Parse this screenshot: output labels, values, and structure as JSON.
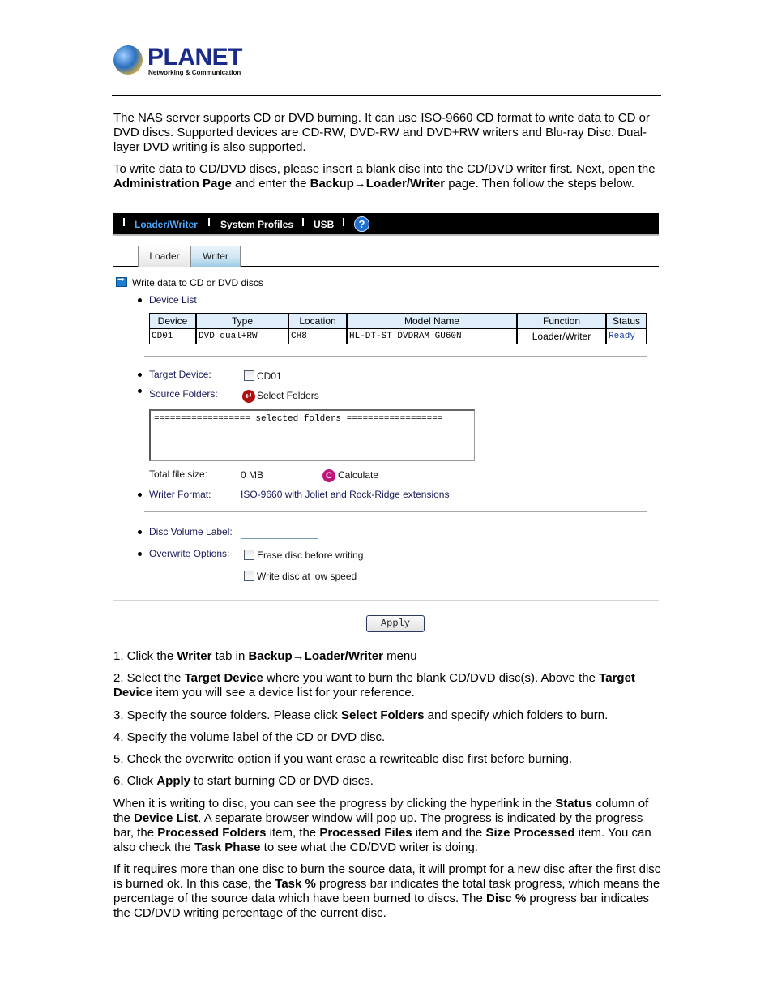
{
  "logo": {
    "brand": "PLANET",
    "tagline": "Networking & Communication"
  },
  "intro": {
    "p1": "The NAS server supports CD or DVD burning. It can use ISO-9660 CD format to write data to CD or DVD discs. Supported devices are CD-RW, DVD-RW and DVD+RW writers and Blu-ray Disc. Dual-layer DVD writing is also supported.",
    "p2_a": "To write data to CD/DVD discs, please insert a blank disc into the CD/DVD writer first. Next, open the ",
    "p2_b": "Administration Page",
    "p2_c": " and enter the ",
    "p2_d": "Backup→Loader/Writer",
    "p2_e": " page. Then follow the steps below."
  },
  "nav": {
    "items": [
      {
        "label": "Loader/Writer",
        "active": true
      },
      {
        "label": "System Profiles",
        "active": false
      },
      {
        "label": "USB",
        "active": false
      }
    ],
    "help_glyph": "?"
  },
  "tabs": [
    {
      "label": "Loader"
    },
    {
      "label": "Writer",
      "active": true
    }
  ],
  "section": {
    "title": "Write data to CD or DVD discs",
    "device_list_label": "Device List",
    "device_table": {
      "headers": [
        "Device",
        "Type",
        "Location",
        "Model Name",
        "Function",
        "Status"
      ],
      "rows": [
        [
          "CD01",
          "DVD dual+RW",
          "CH8",
          "HL-DT-ST DVDRAM GU60N",
          "Loader/Writer",
          "Ready"
        ]
      ]
    },
    "target_device": {
      "label": "Target Device:",
      "option": "CD01",
      "checked": false
    },
    "source_folders": {
      "label": "Source Folders:",
      "button": "Select Folders"
    },
    "folders_box_text": "================== selected folders ==================",
    "total_size": {
      "label": "Total file size:",
      "value": "0 MB",
      "button": "Calculate"
    },
    "writer_format": {
      "label": "Writer Format:",
      "value": "ISO-9660 with Joliet and Rock-Ridge extensions"
    },
    "volume_label": {
      "label": "Disc Volume Label:",
      "value": ""
    },
    "overwrite": {
      "label": "Overwrite Options:",
      "options": [
        {
          "label": "Erase disc before writing",
          "checked": false
        },
        {
          "label": "Write disc at low speed",
          "checked": false
        }
      ]
    },
    "apply_button": "Apply"
  },
  "steps": [
    {
      "html": "1. Click the <b>Writer</b> tab in <b>Backup→Loader/Writer</b> menu"
    },
    {
      "html": "2. Select the <b>Target Device</b> where you want to burn the blank CD/DVD disc(s). Above the <b>Target Device</b> item you will see a device list for your reference."
    },
    {
      "html": "3. Specify the source folders. Please click <b>Select Folders</b> and specify which folders to burn."
    },
    {
      "html": "4. Specify the volume label of the CD or DVD disc."
    },
    {
      "html": "5. Check the overwrite option if you want erase a rewriteable disc first before burning."
    },
    {
      "html": "6. Click <b>Apply</b> to start burning CD or DVD discs."
    }
  ],
  "outro": [
    {
      "html": "When it is writing to disc, you can see the progress by clicking the hyperlink in the <b>Status</b> column of the <b>Device List</b>. A separate browser window will pop up. The progress is indicated by the progress bar, the <b>Processed Folders</b> item, the <b>Processed Files</b> item and the <b>Size Processed</b> item. You can also check the <b>Task Phase</b> to see what the CD/DVD writer is doing."
    },
    {
      "html": "If it requires more than one disc to burn the source data, it will prompt for a new disc after the first disc is burned ok. In this case, the <b>Task %</b> progress bar indicates the total task progress, which means the percentage of the source data which have been burned to discs. The <b>Disc %</b> progress bar indicates the CD/DVD writing percentage of the current disc."
    }
  ]
}
